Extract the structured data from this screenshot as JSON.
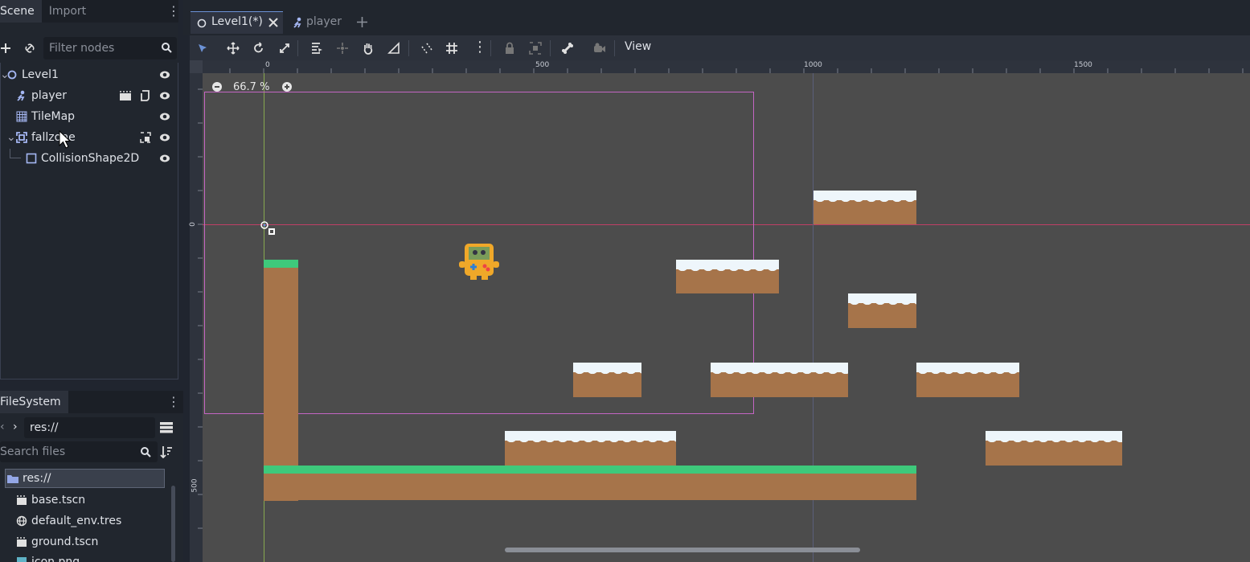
{
  "scene_dock": {
    "tabs": [
      "Scene",
      "Import"
    ],
    "filter_placeholder": "Filter nodes",
    "nodes": [
      {
        "label": "Level1",
        "icon": "node2d-circle-icon"
      },
      {
        "label": "player",
        "icon": "kinematic-body-icon"
      },
      {
        "label": "TileMap",
        "icon": "tilemap-icon"
      },
      {
        "label": "fallzone",
        "icon": "area2d-icon"
      },
      {
        "label": "CollisionShape2D",
        "icon": "collision-shape-icon"
      }
    ]
  },
  "filesystem_dock": {
    "tab": "FileSystem",
    "path": "res://",
    "search_placeholder": "Search files",
    "items": [
      {
        "label": "res://",
        "icon": "folder-icon",
        "selected": true
      },
      {
        "label": "base.tscn",
        "icon": "scene-file-icon"
      },
      {
        "label": "default_env.tres",
        "icon": "globe-icon"
      },
      {
        "label": "ground.tscn",
        "icon": "scene-file-icon"
      },
      {
        "label": "icon.png",
        "icon": "image-icon"
      }
    ]
  },
  "editor_tabs": [
    "Level1(*)",
    "player"
  ],
  "toolbar": {
    "view_label": "View"
  },
  "viewport": {
    "zoom": "66.7 %",
    "ruler_h": [
      "0",
      "500",
      "1000",
      "1500"
    ],
    "ruler_v": [
      "0",
      "500"
    ]
  },
  "colors": {
    "accent": "#6c92d6",
    "camera_rect": "#c465c4",
    "grass": "#3ec97b",
    "dirt": "#a6744a",
    "snow": "#eef6fb"
  }
}
